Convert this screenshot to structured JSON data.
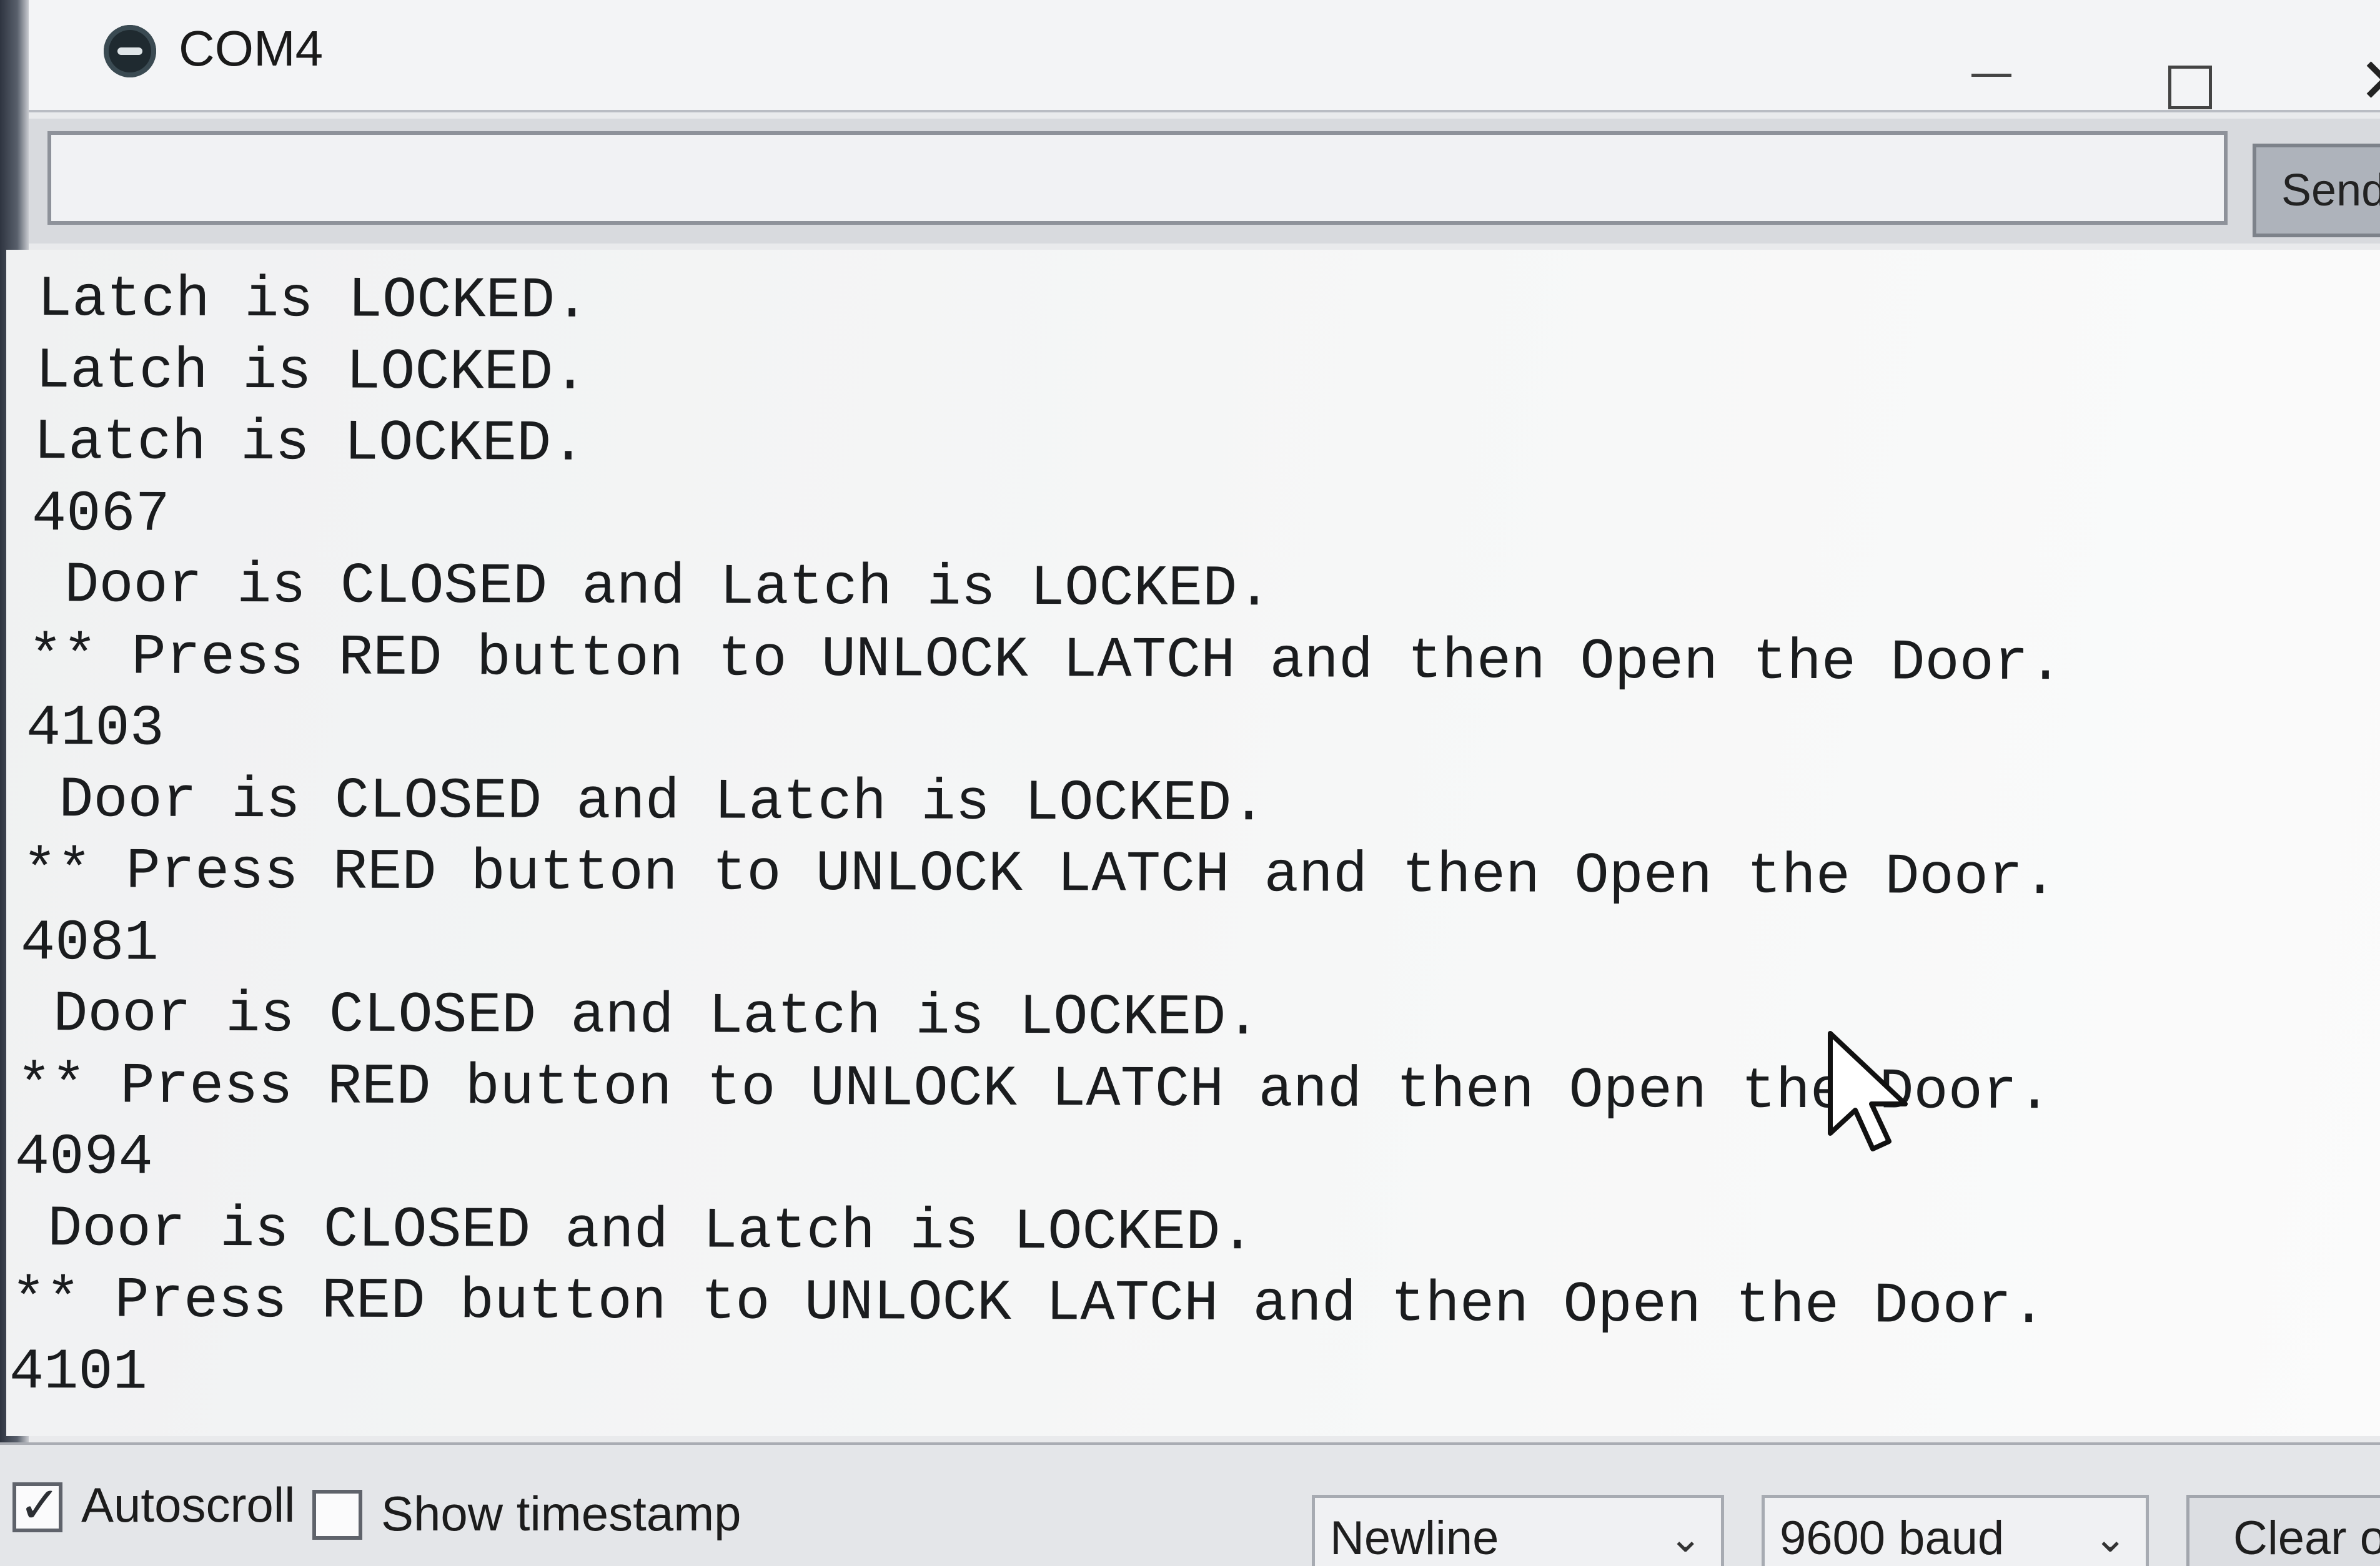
{
  "window": {
    "title": "COM4",
    "minimize_label": "—",
    "maximize_label": "□",
    "close_label": "✕"
  },
  "send_bar": {
    "input_value": "",
    "send_label": "Send"
  },
  "serial_output": {
    "lines": [
      "Latch is LOCKED.",
      "Latch is LOCKED.",
      "Latch is LOCKED.",
      "4067",
      " Door is CLOSED and Latch is LOCKED.",
      "** Press RED button to UNLOCK LATCH and then Open the Door.",
      "4103",
      " Door is CLOSED and Latch is LOCKED.",
      "** Press RED button to UNLOCK LATCH and then Open the Door.",
      "4081",
      " Door is CLOSED and Latch is LOCKED.",
      "** Press RED button to UNLOCK LATCH and then Open the Door.",
      "4094",
      " Door is CLOSED and Latch is LOCKED.",
      "** Press RED button to UNLOCK LATCH and then Open the Door.",
      "4101"
    ]
  },
  "bottom_bar": {
    "autoscroll_label": "Autoscroll",
    "autoscroll_checked": true,
    "timestamp_label": "Show timestamp",
    "timestamp_checked": false,
    "line_ending_selected": "Newline",
    "baud_selected": "9600 baud",
    "clear_label": "Clear output"
  },
  "icons": {
    "app": "arduino-icon",
    "cursor": "mouse-pointer-icon",
    "dropdown": "chevron-down-icon"
  },
  "colors": {
    "background": "#e9eaec",
    "text": "#1a1c1e",
    "accent_button": "#aeb3bb"
  }
}
